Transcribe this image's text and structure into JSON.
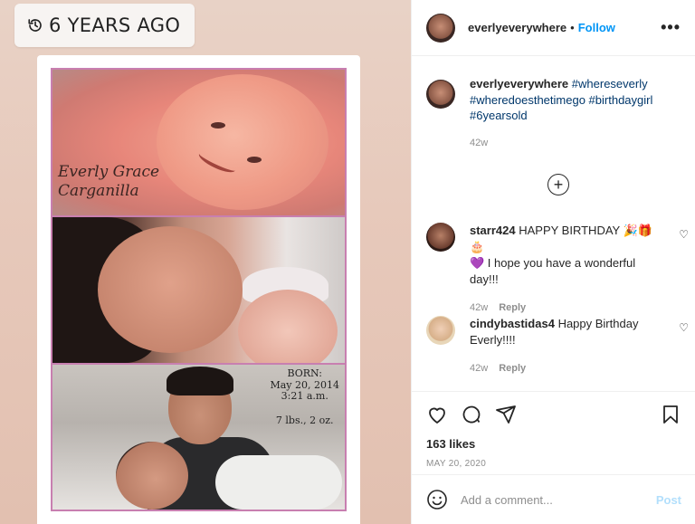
{
  "memory": {
    "label": "6 YEARS AGO",
    "icon": "history-icon"
  },
  "photo": {
    "script_line1": "Everly Grace",
    "script_line2": "Carganilla",
    "born_label": "BORN:",
    "born_date": "May 20, 2014",
    "born_time": "3:21 a.m.",
    "born_weight": "7 lbs., 2 oz."
  },
  "header": {
    "username": "everlyeverywhere",
    "separator": "•",
    "follow": "Follow",
    "more": "•••"
  },
  "caption": {
    "username": "everlyeverywhere",
    "hashtags": [
      "#whereseverly",
      "#wheredoesthetimego",
      "#birthdaygirl",
      "#6yearsold"
    ],
    "age": "42w"
  },
  "load_more_icon": "plus-circle-icon",
  "comments": [
    {
      "username": "starr424",
      "text_line1": "HAPPY BIRTHDAY 🎉🎁🎂",
      "text_line2": "💜 I hope you have a wonderful day!!!",
      "age": "42w",
      "reply": "Reply"
    },
    {
      "username": "cindybastidas4",
      "text": "Happy Birthday Everly!!!!",
      "age": "42w",
      "reply": "Reply"
    }
  ],
  "actions": {
    "likes": "163 likes",
    "date": "MAY 20, 2020"
  },
  "add_comment": {
    "placeholder": "Add a comment...",
    "post": "Post"
  },
  "colors": {
    "link": "#0095f6",
    "hashtag": "#00376b",
    "muted": "#8e8e8e",
    "collage_border": "#c87fb0"
  }
}
